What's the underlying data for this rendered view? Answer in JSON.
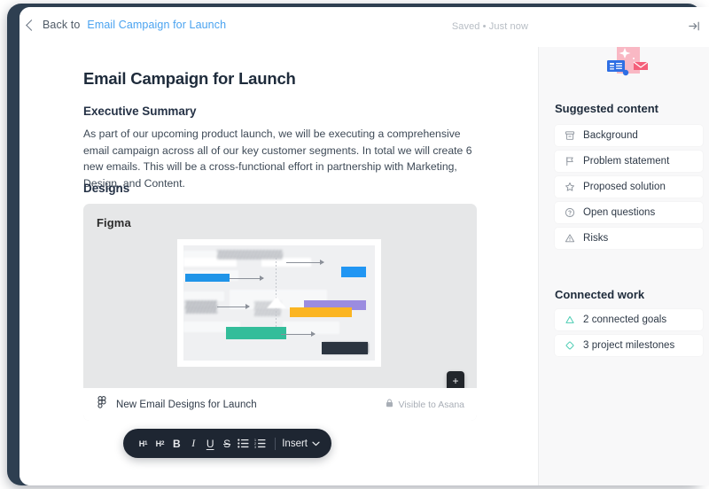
{
  "topbar": {
    "back_label": "Back to",
    "back_link": "Email Campaign for Launch",
    "save_status": "Saved • Just now",
    "collapse_icon": "collapse-right-icon"
  },
  "document": {
    "title": "Email Campaign for Launch",
    "sections": [
      {
        "heading": "Executive Summary",
        "body": "As part of our upcoming product launch, we will be executing a comprehensive email campaign across all of our key customer segments. In total we will create 6 new emails. This will be a cross-functional effort in partnership with Marketing, Design, and Content."
      },
      {
        "heading": "Designs"
      }
    ]
  },
  "figma_embed": {
    "provider_label": "Figma",
    "file_name": "New Email Designs for Launch",
    "visibility_label": "Visible to Asana",
    "visibility_icon": "lock-icon",
    "provider_icon": "figma-logo-icon",
    "zoom_in": "+",
    "zoom_out": "−",
    "canvas_colors": {
      "blue": "#1f94e8",
      "light_blue": "#2196f3",
      "purple": "#9b8ce0",
      "yellow": "#fbb522",
      "teal": "#33bd9a",
      "dark": "#2b3440",
      "canvas_bg": "#eff0f2"
    }
  },
  "toolbar": {
    "buttons": [
      {
        "name": "heading-1",
        "label": "H",
        "sub": "1"
      },
      {
        "name": "heading-2",
        "label": "H",
        "sub": "2"
      },
      {
        "name": "bold",
        "label": "B"
      },
      {
        "name": "italic",
        "label": "I"
      },
      {
        "name": "underline",
        "label": "U"
      },
      {
        "name": "strikethrough",
        "label": "S"
      },
      {
        "name": "bulleted-list",
        "label": "bulleted-list-icon"
      },
      {
        "name": "numbered-list",
        "label": "numbered-list-icon"
      }
    ],
    "insert_label": "Insert",
    "insert_chevron": "chevron-down-icon"
  },
  "sidebar": {
    "illustration": "ai-suggested-content-illustration",
    "suggested": {
      "heading": "Suggested content",
      "items": [
        {
          "label": "Background",
          "icon": "archive-box-icon"
        },
        {
          "label": "Problem statement",
          "icon": "flag-icon"
        },
        {
          "label": "Proposed solution",
          "icon": "star-icon"
        },
        {
          "label": "Open questions",
          "icon": "question-circle-icon"
        },
        {
          "label": "Risks",
          "icon": "warning-triangle-icon"
        }
      ]
    },
    "connected": {
      "heading": "Connected work",
      "items": [
        {
          "label": "2 connected goals",
          "icon": "goal-triangle-icon",
          "color": "#4ecdb4"
        },
        {
          "label": "3 project milestones",
          "icon": "milestone-diamond-icon",
          "color": "#4ecdb4"
        }
      ]
    }
  },
  "colors": {
    "frame": "#2e3f51",
    "link": "#4aa3f0",
    "sidebar_bg": "#f8f8f9",
    "toolbar_bg": "#1e2632"
  }
}
